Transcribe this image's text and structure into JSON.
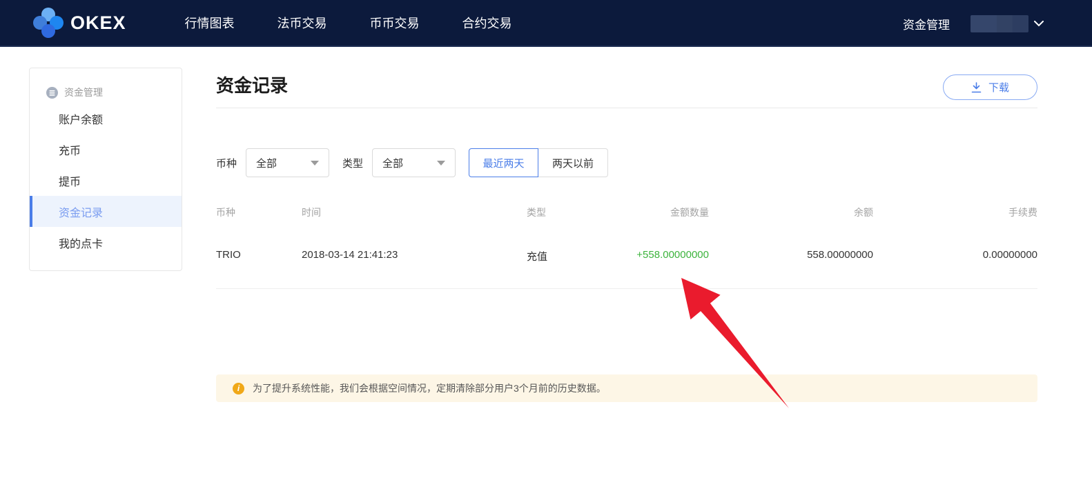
{
  "header": {
    "logo_text": "OKEX",
    "nav": [
      {
        "label": "行情图表"
      },
      {
        "label": "法币交易"
      },
      {
        "label": "币币交易"
      },
      {
        "label": "合约交易"
      }
    ],
    "funds_link": "资金管理"
  },
  "sidebar": {
    "header": "资金管理",
    "items": [
      {
        "label": "账户余额"
      },
      {
        "label": "充币"
      },
      {
        "label": "提币"
      },
      {
        "label": "资金记录"
      },
      {
        "label": "我的点卡"
      }
    ]
  },
  "main": {
    "title": "资金记录",
    "download_label": "下载",
    "filters": {
      "currency_label": "币种",
      "currency_value": "全部",
      "type_label": "类型",
      "type_value": "全部",
      "tabs": [
        {
          "label": "最近两天"
        },
        {
          "label": "两天以前"
        }
      ]
    },
    "table": {
      "headers": [
        "币种",
        "时间",
        "类型",
        "金额数量",
        "余额",
        "手续费"
      ],
      "rows": [
        [
          "TRIO",
          "2018-03-14 21:41:23",
          "充值",
          "+558.00000000",
          "558.00000000",
          "0.00000000"
        ]
      ]
    },
    "notice": {
      "icon": "info-icon",
      "text": "为了提升系统性能，我们会根据空间情况，定期清除部分用户3个月前的历史数据。"
    }
  },
  "colors": {
    "topbar_bg": "#0c1a3c",
    "accent_blue": "#4a7de8",
    "active_item_bg": "#edf3fd",
    "positive_green": "#3cb33c",
    "notice_bg": "#fdf6e6",
    "notice_icon": "#f0a818",
    "annotation_red": "#ea1b2d"
  }
}
